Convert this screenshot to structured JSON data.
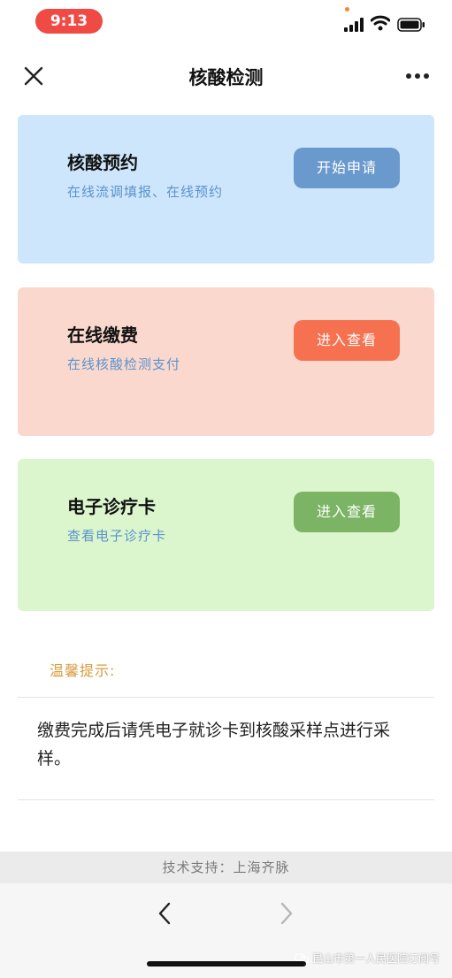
{
  "status_bar": {
    "time": "9:13"
  },
  "nav": {
    "title": "核酸检测"
  },
  "cards": [
    {
      "title": "核酸预约",
      "subtitle": "在线流调填报、在线预约",
      "button": "开始申请"
    },
    {
      "title": "在线缴费",
      "subtitle": "在线核酸检测支付",
      "button": "进入查看"
    },
    {
      "title": "电子诊疗卡",
      "subtitle": "查看电子诊疗卡",
      "button": "进入查看"
    }
  ],
  "tips": {
    "label": "温馨提示:",
    "text": "缴费完成后请凭电子就诊卡到核酸采样点进行采样。"
  },
  "footer": {
    "support": "技术支持：上海齐脉"
  },
  "watermark": {
    "text": "昆山市第一人民医院订阅号"
  },
  "colors": {
    "time_pill": "#f04a45",
    "card_blue": "#cde6fb",
    "card_orange": "#fad8cd",
    "card_green": "#dbf6cd",
    "btn_blue": "#6a99cd",
    "btn_orange": "#f57150",
    "btn_green": "#7bb464",
    "subtitle": "#5b93cd",
    "tips_label": "#d89a3c"
  },
  "icons": [
    "signal-icon",
    "wifi-icon",
    "battery-icon",
    "close-icon",
    "more-icon",
    "back-icon",
    "forward-icon"
  ]
}
